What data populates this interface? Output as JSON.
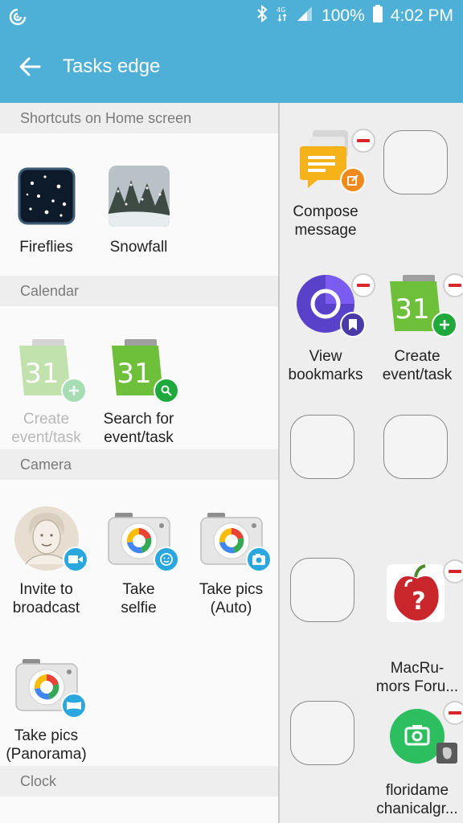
{
  "status": {
    "battery": "100%",
    "time": "4:02 PM"
  },
  "appbar": {
    "title": "Tasks edge"
  },
  "sections": {
    "shortcuts": "Shortcuts on Home screen",
    "calendar": "Calendar",
    "camera": "Camera",
    "clock": "Clock"
  },
  "shortcuts": {
    "fireflies": "Fireflies",
    "snowfall": "Snowfall"
  },
  "calendar": {
    "create": "Create\nevent/task",
    "search": "Search for\nevent/task",
    "icon_day": "31"
  },
  "camera": {
    "broadcast": "Invite to\nbroadcast",
    "selfie": "Take\nselfie",
    "auto": "Take pics\n(Auto)",
    "panorama": "Take pics\n(Panorama)"
  },
  "edge": {
    "compose": "Compose\nmessage",
    "bookmarks": "View\nbookmarks",
    "create_event": "Create\nevent/task",
    "macrumors": "MacRu-\nmors Foru...",
    "florida": "floridame\nchanicalgr..."
  },
  "colors": {
    "accent": "#4eb0d6",
    "remove": "#d9262c"
  }
}
